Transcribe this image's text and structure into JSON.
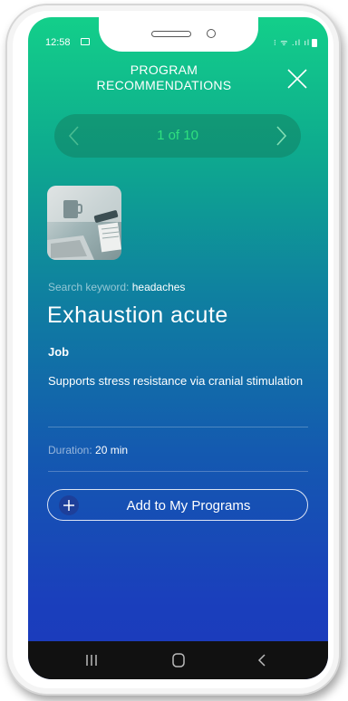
{
  "status_bar": {
    "time": "12:58",
    "icons_text": "⁝ ᯤ .ıl ıl"
  },
  "header": {
    "title_line1": "PROGRAM",
    "title_line2": "RECOMMENDATIONS",
    "close_icon": "close-icon"
  },
  "pager": {
    "label": "1 of 10",
    "prev_icon": "chevron-left-icon",
    "next_icon": "chevron-right-icon"
  },
  "program": {
    "image_icon": "desk-coffee-laptop-photo",
    "keyword_label": "Search keyword:",
    "keyword_value": "headaches",
    "title": "Exhaustion acute",
    "category": "Job",
    "description": "Supports stress resistance via cranial stimulation",
    "duration_label": "Duration:",
    "duration_value": "20 min",
    "add_button_label": "Add to My Programs",
    "add_button_icon": "plus-icon"
  },
  "colors": {
    "gradient_top": "#13cf8a",
    "gradient_bottom": "#1c39bd",
    "pager_text": "#2fe07f",
    "plus_circle": "#1d3f9a"
  }
}
